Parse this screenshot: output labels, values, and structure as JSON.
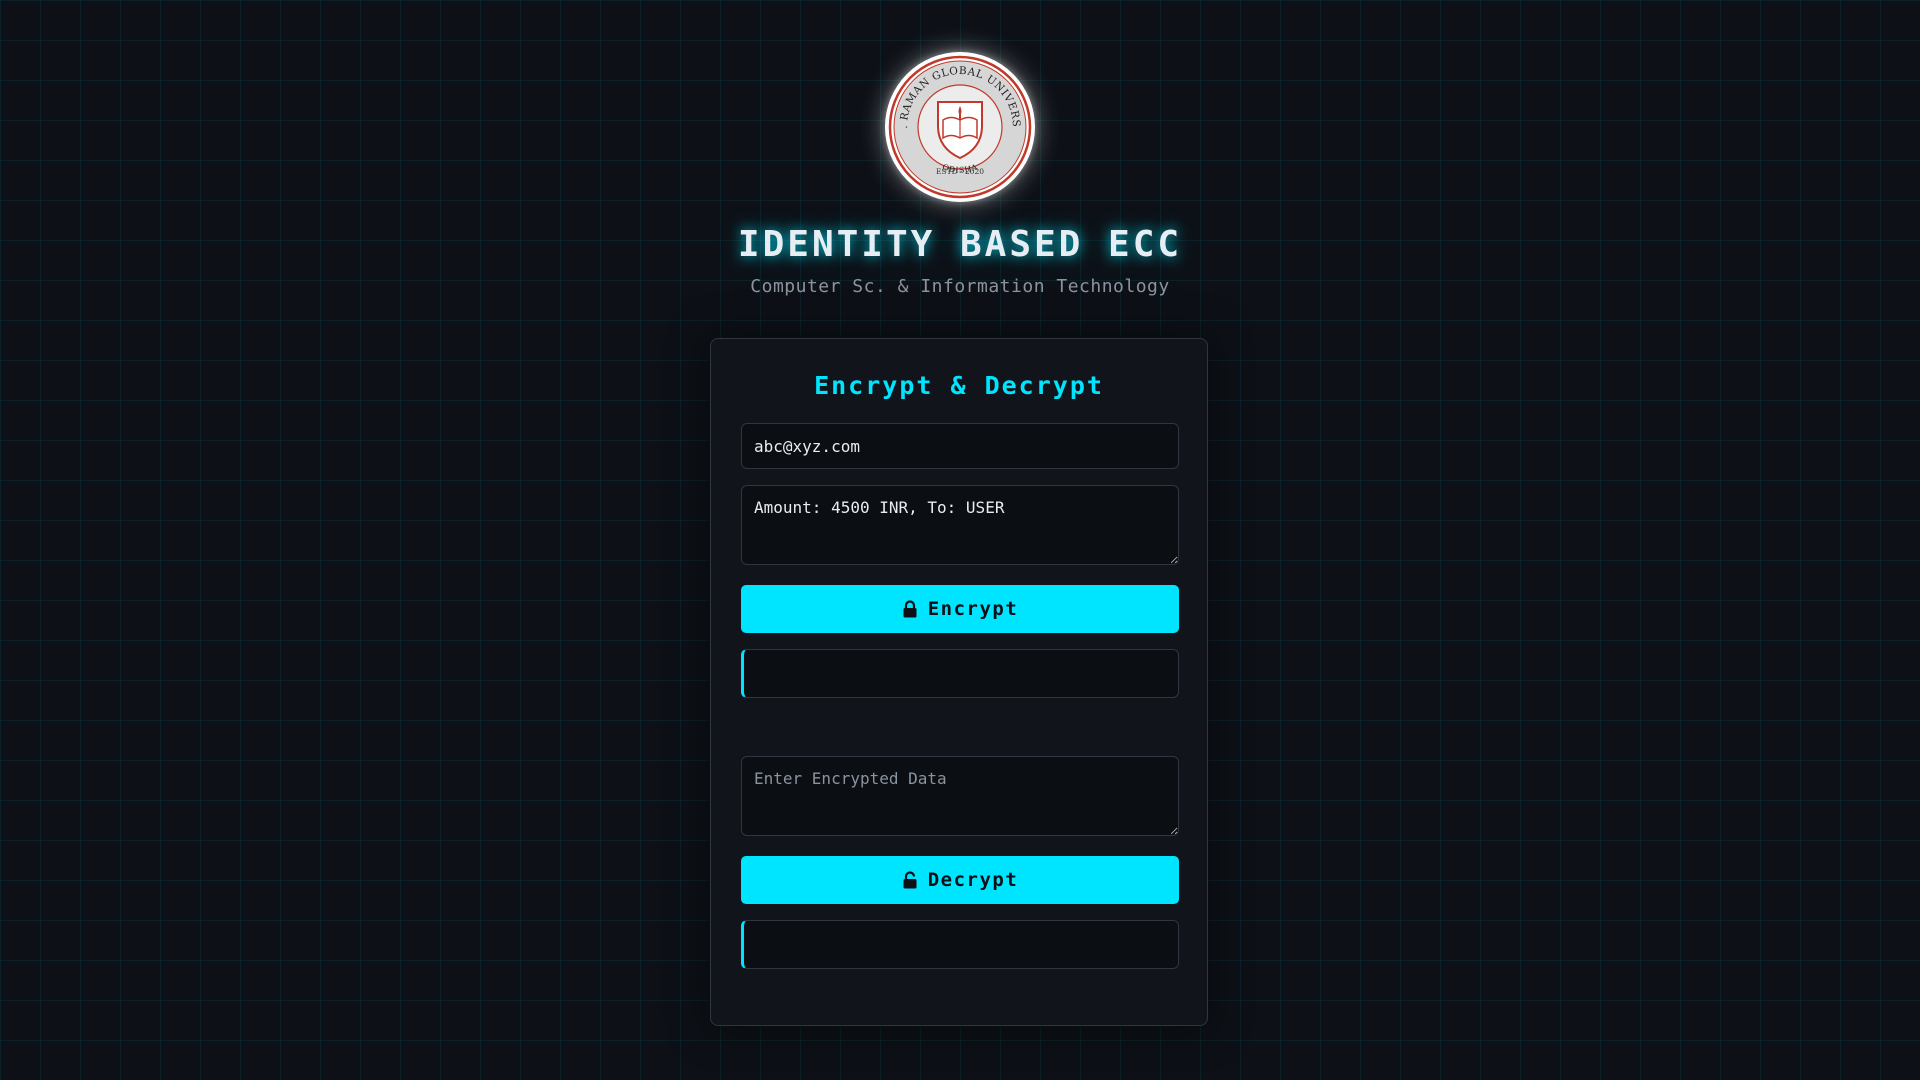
{
  "header": {
    "logo": {
      "university_arc": "C.V. RAMAN GLOBAL UNIVERSITY",
      "state": "ODISHA",
      "estd": "ESTD - 2020"
    },
    "title": "IDENTITY BASED ECC",
    "subtitle": "Computer Sc. & Information Technology"
  },
  "card": {
    "title": "Encrypt & Decrypt",
    "email_input": {
      "value": "abc@xyz.com"
    },
    "message_input": {
      "value": "Amount: 4500 INR, To: USER"
    },
    "encrypt_button": {
      "label": "Encrypt",
      "icon": "lock-icon"
    },
    "encrypt_output": {
      "value": ""
    },
    "encrypted_input": {
      "value": "",
      "placeholder": "Enter Encrypted Data"
    },
    "decrypt_button": {
      "label": "Decrypt",
      "icon": "unlock-icon"
    },
    "decrypt_output": {
      "value": ""
    }
  },
  "colors": {
    "accent": "#00e5ff",
    "background": "#0d1117",
    "card": "#11151b",
    "seal_red": "#c0392b"
  }
}
